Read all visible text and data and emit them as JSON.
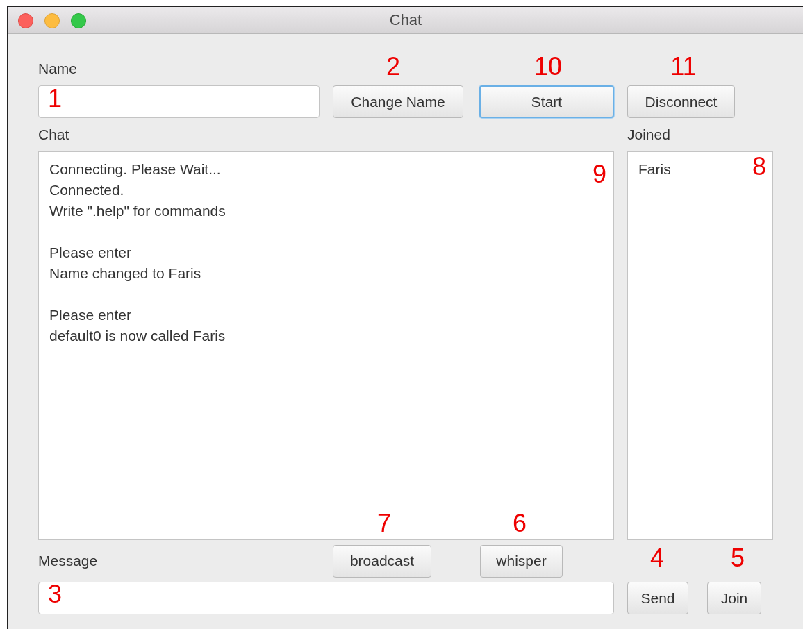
{
  "window": {
    "title": "Chat"
  },
  "name_label": "Name",
  "top_buttons": [
    {
      "label": "Change Name",
      "focused": false
    },
    {
      "label": "Start",
      "focused": true
    },
    {
      "label": "Disconnect",
      "focused": false
    }
  ],
  "chat_label": "Chat",
  "joined_label": "Joined",
  "chat_log": [
    [
      "Connecting. Please Wait...",
      "Connected.",
      "Write \".help\" for commands"
    ],
    [
      "Please enter",
      "Name changed to Faris"
    ],
    [
      "Please enter",
      "default0 is now called Faris"
    ]
  ],
  "joined": [
    "Faris"
  ],
  "message_label": "Message",
  "mode_buttons": [
    "broadcast",
    "whisper"
  ],
  "bottom_buttons": [
    "Send",
    "Join"
  ],
  "annotations": [
    "2",
    "10",
    "11",
    "1",
    "9",
    "8",
    "7",
    "6",
    "4",
    "5",
    "3"
  ]
}
